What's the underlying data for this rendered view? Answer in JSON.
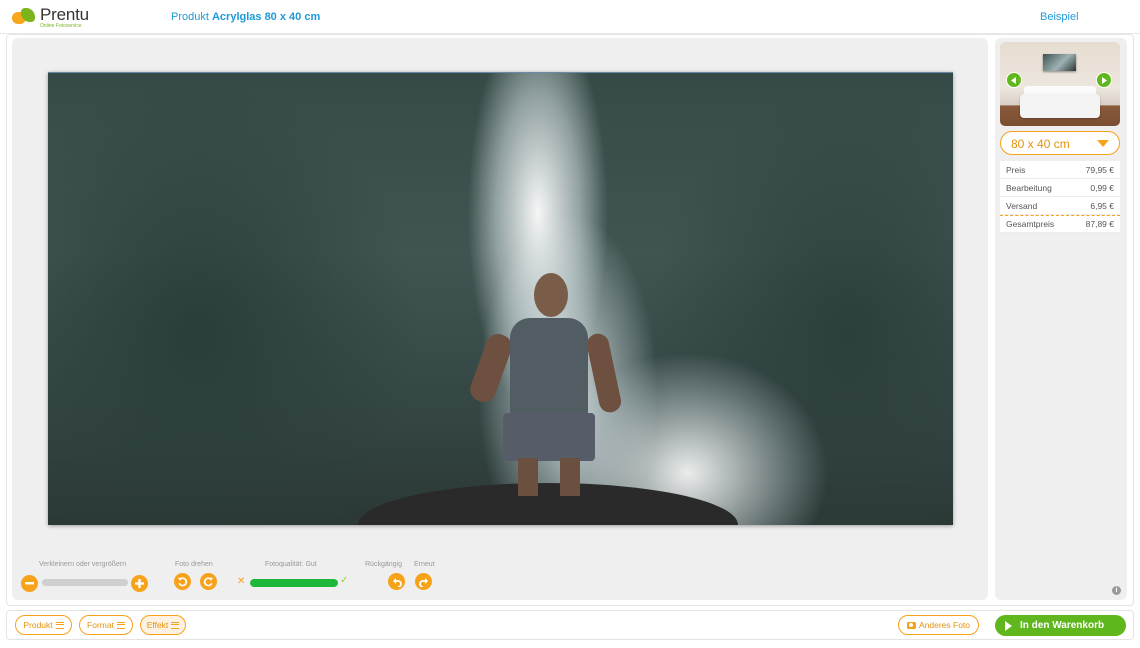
{
  "header": {
    "logo_name": "Prentu",
    "logo_tagline": "Online Fotoservice",
    "product_prefix": "Produkt",
    "product_name": "Acrylglas 80 x 40 cm",
    "example_link": "Beispiel"
  },
  "controls": {
    "zoom_label": "Verkleinern oder vergrößern",
    "rotate_label": "Foto drehen",
    "quality_label": "Fotoqualität: Gut",
    "quality_level_percent": 100,
    "undo_label": "Rückgängig",
    "redo_label": "Erneut"
  },
  "side": {
    "size_value": "80 x 40 cm",
    "prices": [
      {
        "label": "Preis",
        "value": "79,95 €"
      },
      {
        "label": "Bearbeitung",
        "value": "0,99 €"
      },
      {
        "label": "Versand",
        "value": "6,95 €"
      },
      {
        "label": "Gesamtpreis",
        "value": "87,89 €"
      }
    ],
    "info": "i"
  },
  "bottom": {
    "tabs": [
      {
        "label": "Produkt"
      },
      {
        "label": "Format"
      },
      {
        "label": "Effekt"
      }
    ],
    "other_photo": "Anderes Foto",
    "cart": "In den Warenkorb"
  },
  "colors": {
    "accent_orange": "#f7a21b",
    "link_blue": "#1e9ad6",
    "green": "#5fb61d",
    "quality_green": "#1db83a"
  }
}
